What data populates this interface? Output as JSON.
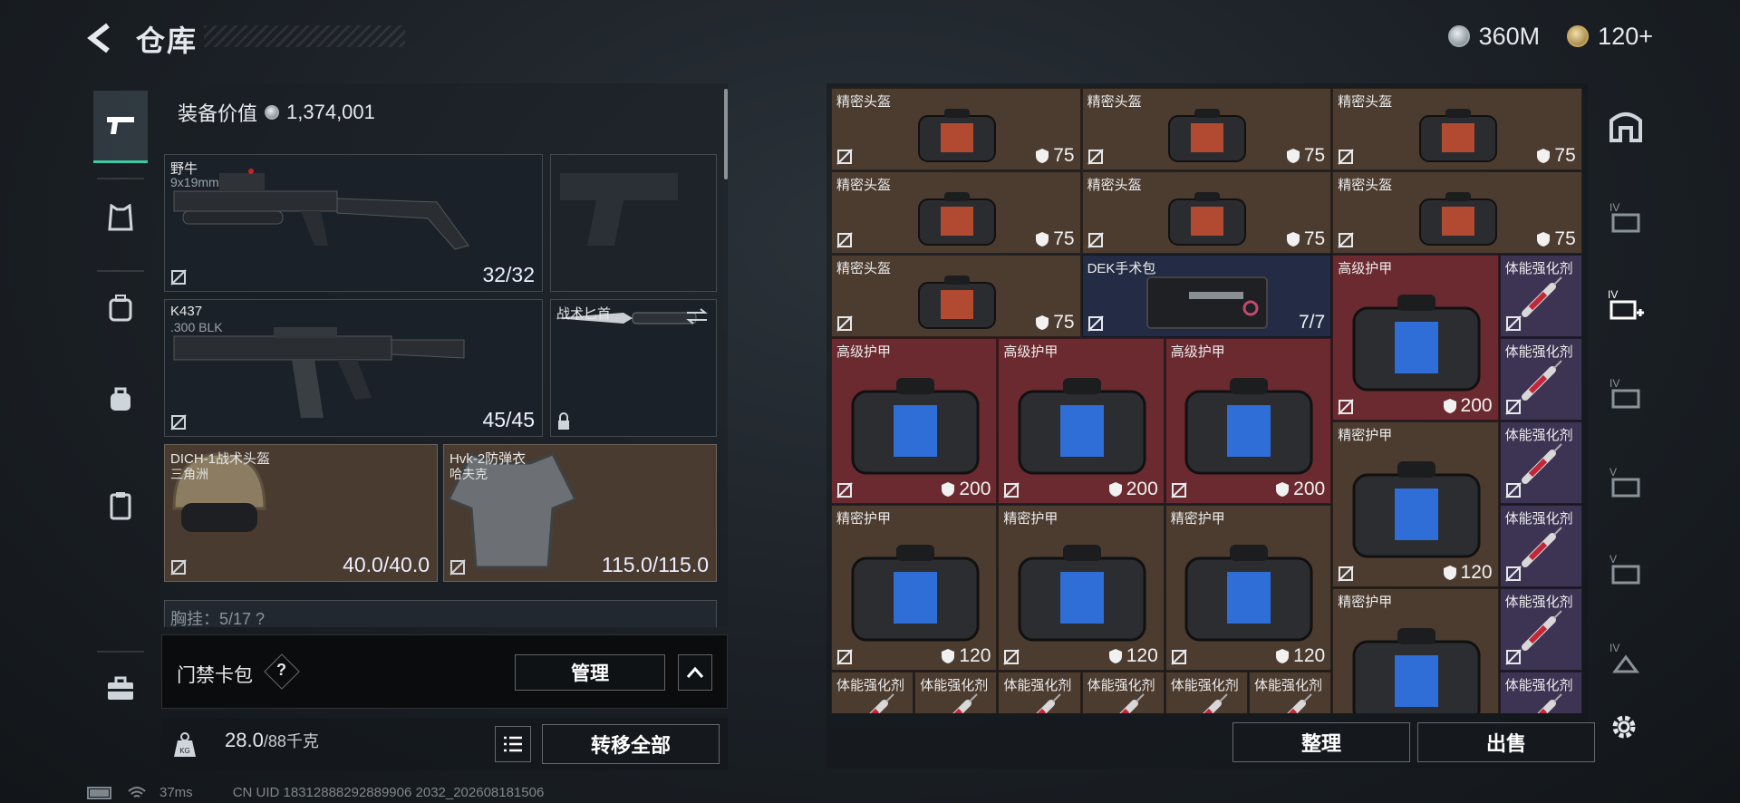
{
  "header": {
    "title": "仓库",
    "currency_silver": "360M",
    "currency_gold": "120+"
  },
  "equip": {
    "value_label": "装备价值",
    "value": "1,374,001",
    "primary": {
      "name": "野牛",
      "caliber": "9x19mm",
      "ammo": "32/32"
    },
    "secondary": {
      "name": "K437",
      "caliber": ".300 BLK",
      "ammo": "45/45"
    },
    "melee": {
      "name": "战术匕首"
    },
    "helmet": {
      "name": "DICH-1战术头盔",
      "origin": "三角洲",
      "durability": "40.0/40.0"
    },
    "armor": {
      "name": "Hvk-2防弹衣",
      "origin": "哈夫克",
      "durability": "115.0/115.0"
    },
    "chest_rig_partial": "胸挂：5/17 ?"
  },
  "card_pack": {
    "label": "门禁卡包",
    "help": "?",
    "manage": "管理"
  },
  "weight": {
    "current": "28.0",
    "max": "/88千克"
  },
  "buttons": {
    "transfer_all": "转移全部",
    "sort": "整理",
    "sell": "出售"
  },
  "status": {
    "ping": "37ms",
    "uid": "CN UID 18312888292889906 2032_202608181506"
  },
  "storage": {
    "items": [
      {
        "name": "精密头盔",
        "value": "75",
        "kind": "helmet",
        "color": "brown"
      },
      {
        "name": "精密头盔",
        "value": "75",
        "kind": "helmet",
        "color": "brown"
      },
      {
        "name": "精密头盔",
        "value": "75",
        "kind": "helmet",
        "color": "brown"
      },
      {
        "name": "精密头盔",
        "value": "75",
        "kind": "helmet",
        "color": "brown"
      },
      {
        "name": "精密头盔",
        "value": "75",
        "kind": "helmet",
        "color": "brown"
      },
      {
        "name": "精密头盔",
        "value": "75",
        "kind": "helmet",
        "color": "brown"
      },
      {
        "name": "精密头盔",
        "value": "75",
        "kind": "helmet",
        "color": "brown"
      },
      {
        "name": "DEK手术包",
        "value": "7/7",
        "kind": "medkit",
        "color": "navy"
      },
      {
        "name": "高级护甲",
        "value": "200",
        "kind": "armor-blue",
        "color": "red"
      },
      {
        "name": "体能强化剂",
        "value": "",
        "kind": "syringe",
        "color": "purple"
      },
      {
        "name": "高级护甲",
        "value": "200",
        "kind": "armor-blue",
        "color": "red"
      },
      {
        "name": "高级护甲",
        "value": "200",
        "kind": "armor-blue",
        "color": "red"
      },
      {
        "name": "高级护甲",
        "value": "200",
        "kind": "armor-blue",
        "color": "red"
      },
      {
        "name": "体能强化剂",
        "value": "",
        "kind": "syringe",
        "color": "purple"
      },
      {
        "name": "精密护甲",
        "value": "120",
        "kind": "armor",
        "color": "brown"
      },
      {
        "name": "体能强化剂",
        "value": "",
        "kind": "syringe",
        "color": "purple"
      },
      {
        "name": "体能强化剂",
        "value": "",
        "kind": "syringe",
        "color": "purple"
      },
      {
        "name": "精密护甲",
        "value": "120",
        "kind": "armor",
        "color": "brown"
      },
      {
        "name": "精密护甲",
        "value": "120",
        "kind": "armor",
        "color": "brown"
      },
      {
        "name": "精密护甲",
        "value": "120",
        "kind": "armor",
        "color": "brown"
      },
      {
        "name": "体能强化剂",
        "value": "",
        "kind": "syringe",
        "color": "purple"
      },
      {
        "name": "精密护甲",
        "value": "",
        "kind": "armor",
        "color": "brown"
      },
      {
        "name": "体能强化剂",
        "value": "",
        "kind": "syringe",
        "color": "purple"
      },
      {
        "name": "体能强化剂",
        "value": "",
        "kind": "syringe",
        "color": "brown"
      },
      {
        "name": "体能强化剂",
        "value": "",
        "kind": "syringe",
        "color": "brown"
      },
      {
        "name": "体能强化剂",
        "value": "",
        "kind": "syringe",
        "color": "brown"
      },
      {
        "name": "体能强化剂",
        "value": "",
        "kind": "syringe",
        "color": "brown"
      },
      {
        "name": "体能强化剂",
        "value": "",
        "kind": "syringe",
        "color": "brown"
      },
      {
        "name": "体能强化剂",
        "value": "",
        "kind": "syringe",
        "color": "brown"
      }
    ]
  },
  "colors": {
    "accent": "#3ec9a4",
    "brown": "#4c3c30",
    "red": "#6b2a30",
    "navy": "#232c44",
    "purple": "#3d3352"
  }
}
